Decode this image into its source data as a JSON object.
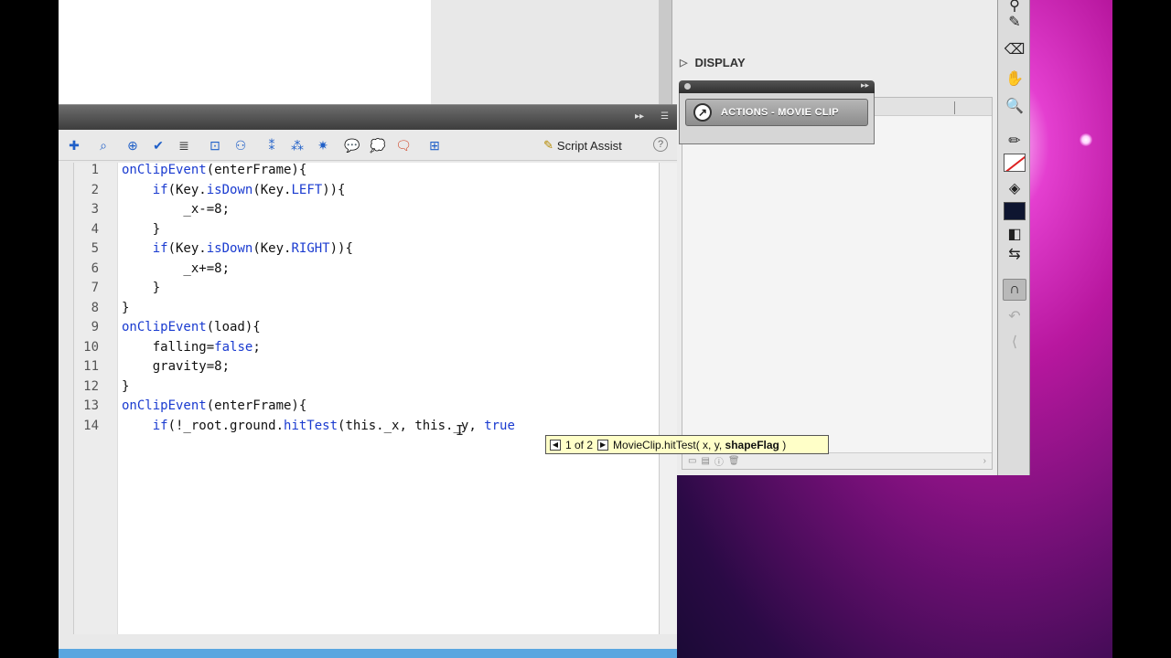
{
  "display_section": {
    "label": "DISPLAY"
  },
  "drag_proxy": {
    "label": "ACTIONS - MOVIE CLIP",
    "icon": "arrow-symbol-icon"
  },
  "actions_panel": {
    "toolbar": {
      "script_assist_label": "Script Assist",
      "help_label": "?"
    },
    "lines": [
      {
        "n": "1"
      },
      {
        "n": "2"
      },
      {
        "n": "3"
      },
      {
        "n": "4"
      },
      {
        "n": "5"
      },
      {
        "n": "6"
      },
      {
        "n": "7"
      },
      {
        "n": "8"
      },
      {
        "n": "9"
      },
      {
        "n": "10"
      },
      {
        "n": "11"
      },
      {
        "n": "12"
      },
      {
        "n": "13"
      },
      {
        "n": "14"
      }
    ],
    "code": {
      "l1a": "onClipEvent",
      "l1b": "(enterFrame){",
      "l2a": "    if",
      "l2b": "(Key.",
      "l2c": "isDown",
      "l2d": "(Key.",
      "l2e": "LEFT",
      "l2f": ")){",
      "l3": "        _x-=8;",
      "l4": "    }",
      "l5a": "    if",
      "l5b": "(Key.",
      "l5c": "isDown",
      "l5d": "(Key.",
      "l5e": "RIGHT",
      "l5f": ")){",
      "l6": "        _x+=8;",
      "l7": "    }",
      "l8": "}",
      "l9a": "onClipEvent",
      "l9b": "(load){",
      "l10a": "    falling=",
      "l10b": "false",
      "l10c": ";",
      "l11": "    gravity=8;",
      "l12": "}",
      "l13a": "onClipEvent",
      "l13b": "(enterFrame){",
      "l14a": "    if",
      "l14b": "(!_root.ground.",
      "l14c": "hitTest",
      "l14d": "(this._x, this._y, ",
      "l14e": "true"
    }
  },
  "code_hint": {
    "counter": "1 of 2",
    "signature_prefix": "MovieClip.hitTest( x, y, ",
    "signature_bold": "shapeFlag",
    "signature_suffix": " )"
  },
  "colors": {
    "keyword": "#1a3bd0",
    "status_bar": "#5aa6e0",
    "tooltip_bg": "#ffffc8"
  }
}
